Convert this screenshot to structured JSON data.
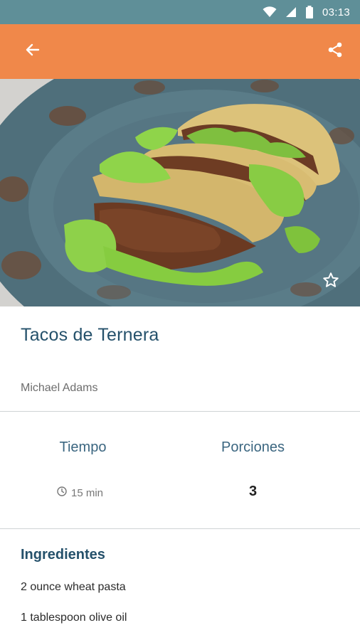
{
  "status_bar": {
    "time": "03:13",
    "icons": [
      "wifi-icon",
      "signal-icon",
      "battery-icon"
    ]
  },
  "app_bar": {
    "back_icon": "arrow-back-icon",
    "share_icon": "share-icon",
    "color": "#f0884a"
  },
  "hero": {
    "image_description_icon": "tacos-photo",
    "favorite_icon": "star-outline-icon"
  },
  "recipe": {
    "title": "Tacos de Ternera",
    "author": "Michael Adams"
  },
  "info": {
    "time_label": "Tiempo",
    "time_value": "15 min",
    "servings_label": "Porciones",
    "servings_value": "3"
  },
  "ingredients": {
    "heading": "Ingredientes",
    "items": [
      "2 ounce wheat pasta",
      "1 tablespoon olive oil"
    ]
  },
  "colors": {
    "status_bar": "#5f8f98",
    "accent": "#f0884a",
    "title": "#25516b"
  }
}
